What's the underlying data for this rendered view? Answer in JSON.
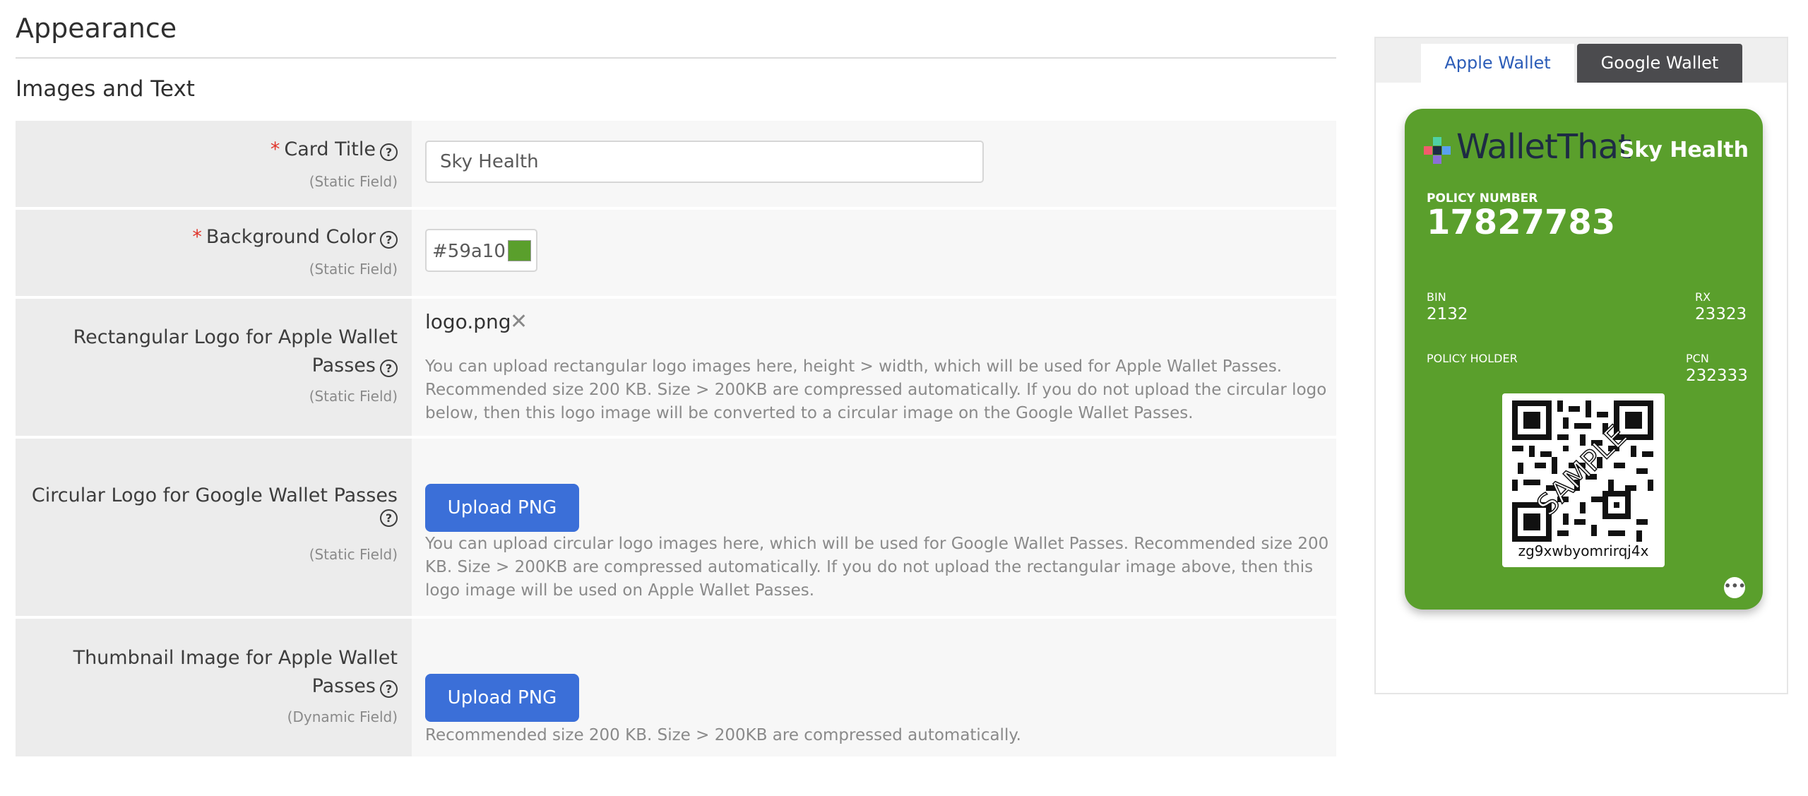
{
  "page": {
    "title": "Appearance",
    "section_title": "Images and Text"
  },
  "form": {
    "card_title": {
      "required_mark": "*",
      "label": "Card Title",
      "sub": "(Static Field)",
      "value": "Sky Health"
    },
    "background_color": {
      "required_mark": "*",
      "label": "Background Color",
      "sub": "(Static Field)",
      "value": "#59a10:",
      "swatch_color": "#5a9f2c"
    },
    "rect_logo": {
      "label_line1": "Rectangular Logo for Apple Wallet",
      "label_line2": "Passes",
      "sub": "(Static Field)",
      "filename": "logo.png",
      "remove_glyph": "✕",
      "help": "You can upload rectangular logo images here, height > width, which will be used for Apple Wallet Passes. Recommended size 200 KB. Size > 200KB are compressed automatically. If you do not upload the circular logo below, then this logo image will be converted to a circular image on the Google Wallet Passes."
    },
    "circular_logo": {
      "label_line1": "Circular Logo for Google Wallet Passes",
      "sub": "(Static Field)",
      "button": "Upload PNG",
      "help": "You can upload circular logo images here, which will be used for Google Wallet Passes. Recommended size 200 KB. Size > 200KB are compressed automatically. If you do not upload the rectangular image above, then this logo image will be used on Apple Wallet Passes."
    },
    "thumbnail": {
      "label_line1": "Thumbnail Image for Apple Wallet",
      "label_line2": "Passes",
      "sub": "(Dynamic Field)",
      "button": "Upload PNG",
      "help": "Recommended size 200 KB. Size > 200KB are compressed automatically."
    }
  },
  "help_icon_glyph": "?",
  "preview": {
    "tabs": [
      {
        "label": "Apple Wallet",
        "active": true
      },
      {
        "label": "Google Wallet",
        "active": false
      }
    ],
    "card": {
      "background": "#5a9f2c",
      "brand": "WalletThat",
      "title": "Sky Health",
      "policy_number_label": "POLICY NUMBER",
      "policy_number": "17827783",
      "bin_label": "BIN",
      "bin": "2132",
      "rx_label": "RX",
      "rx": "23323",
      "policy_holder_label": "POLICY HOLDER",
      "pcn_label": "PCN",
      "pcn": "232333",
      "qr_watermark": "SAMPLE",
      "qr_alt_text": "zg9xwbyomrirqj4x",
      "more_glyph": "•••"
    }
  }
}
